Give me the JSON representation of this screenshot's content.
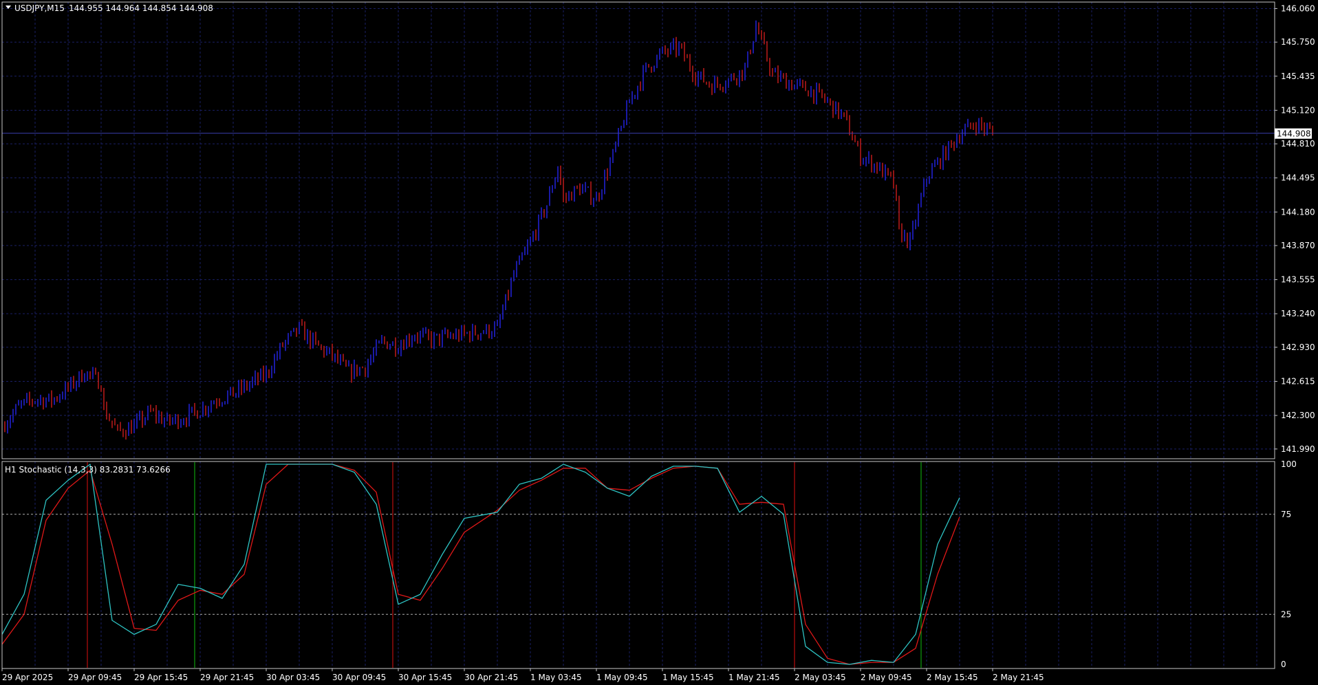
{
  "header": {
    "symbol_label": "USDJPY,M15",
    "ohlc_text": "144.955 144.964 144.854 144.908"
  },
  "price_axis": {
    "tick_labels": [
      "146.060",
      "145.750",
      "145.435",
      "145.120",
      "144.810",
      "144.495",
      "144.180",
      "143.870",
      "143.555",
      "143.240",
      "142.930",
      "142.615",
      "142.300",
      "141.990"
    ],
    "current_price_label": "144.908"
  },
  "indicator": {
    "label": "H1 Stochastic (14,3,3) 83.2831 73.6266",
    "levels": [
      "100",
      "75",
      "25",
      "0"
    ],
    "main_value": "83.2831",
    "signal_value": "73.6266"
  },
  "time_axis": {
    "tick_labels": [
      "29 Apr 2025",
      "29 Apr 09:45",
      "29 Apr 15:45",
      "29 Apr 21:45",
      "30 Apr 03:45",
      "30 Apr 09:45",
      "30 Apr 15:45",
      "30 Apr 21:45",
      "1 May 03:45",
      "1 May 09:45",
      "1 May 15:45",
      "1 May 21:45",
      "2 May 03:45",
      "2 May 09:45",
      "2 May 15:45",
      "2 May 21:45"
    ]
  },
  "colors": {
    "background": "#000000",
    "grid": "#1a1f66",
    "bull_bar": "#2828ff",
    "bear_bar": "#dc2020",
    "stoch_main": "#2ec4c4",
    "stoch_signal": "#e01818",
    "cross_up_line": "#10c010",
    "cross_down_line": "#e01010",
    "axis_text": "#ffffff"
  },
  "chart_data": [
    {
      "type": "candlestick",
      "symbol": "USDJPY",
      "timeframe": "M15",
      "ylim": [
        141.9,
        146.12
      ],
      "x_range": [
        "29 Apr 2025 03:45",
        "3 May 2025 03:45"
      ],
      "grid": true,
      "x_labels": [
        "29 Apr 2025",
        "29 Apr 09:45",
        "29 Apr 15:45",
        "29 Apr 21:45",
        "30 Apr 03:45",
        "30 Apr 09:45",
        "30 Apr 15:45",
        "30 Apr 21:45",
        "1 May 03:45",
        "1 May 09:45",
        "1 May 15:45",
        "1 May 21:45",
        "2 May 03:45",
        "2 May 09:45",
        "2 May 15:45",
        "2 May 21:45"
      ],
      "close_path": [
        [
          "29 Apr 03:45",
          142.2
        ],
        [
          "29 Apr 05:15",
          142.38
        ],
        [
          "29 Apr 06:45",
          142.45
        ],
        [
          "29 Apr 08:15",
          142.44
        ],
        [
          "29 Apr 09:45",
          142.55
        ],
        [
          "29 Apr 11:15",
          142.7
        ],
        [
          "29 Apr 12:45",
          142.6
        ],
        [
          "29 Apr 13:00",
          142.35
        ],
        [
          "29 Apr 14:15",
          142.15
        ],
        [
          "29 Apr 15:45",
          142.2
        ],
        [
          "29 Apr 17:15",
          142.33
        ],
        [
          "29 Apr 18:45",
          142.24
        ],
        [
          "29 Apr 20:15",
          142.28
        ],
        [
          "29 Apr 21:45",
          142.35
        ],
        [
          "29 Apr 23:15",
          142.45
        ],
        [
          "30 Apr 00:45",
          142.5
        ],
        [
          "30 Apr 03:45",
          142.68
        ],
        [
          "30 Apr 05:15",
          142.95
        ],
        [
          "30 Apr 06:45",
          143.1
        ],
        [
          "30 Apr 08:15",
          142.95
        ],
        [
          "30 Apr 09:45",
          142.85
        ],
        [
          "30 Apr 11:15",
          142.7
        ],
        [
          "30 Apr 12:45",
          142.75
        ],
        [
          "30 Apr 14:15",
          142.98
        ],
        [
          "30 Apr 15:45",
          142.95
        ],
        [
          "30 Apr 17:15",
          143.05
        ],
        [
          "30 Apr 18:45",
          143.0
        ],
        [
          "30 Apr 21:45",
          143.05
        ],
        [
          "1 May 00:45",
          143.1
        ],
        [
          "1 May 02:15",
          143.6
        ],
        [
          "1 May 03:45",
          143.9
        ],
        [
          "1 May 05:15",
          144.25
        ],
        [
          "1 May 06:15",
          144.6
        ],
        [
          "1 May 06:45",
          144.3
        ],
        [
          "1 May 08:15",
          144.4
        ],
        [
          "1 May 09:45",
          144.3
        ],
        [
          "1 May 11:15",
          144.7
        ],
        [
          "1 May 12:45",
          145.2
        ],
        [
          "1 May 14:15",
          145.5
        ],
        [
          "1 May 15:45",
          145.65
        ],
        [
          "1 May 17:15",
          145.7
        ],
        [
          "1 May 18:45",
          145.45
        ],
        [
          "1 May 20:15",
          145.35
        ],
        [
          "1 May 21:45",
          145.4
        ],
        [
          "1 May 23:15",
          145.5
        ],
        [
          "2 May 00:15",
          145.9
        ],
        [
          "2 May 01:45",
          145.45
        ],
        [
          "2 May 03:45",
          145.35
        ],
        [
          "2 May 05:15",
          145.3
        ],
        [
          "2 May 06:45",
          145.2
        ],
        [
          "2 May 08:15",
          145.05
        ],
        [
          "2 May 09:45",
          144.7
        ],
        [
          "2 May 11:15",
          144.6
        ],
        [
          "2 May 12:45",
          144.45
        ],
        [
          "2 May 13:15",
          144.0
        ],
        [
          "2 May 14:15",
          143.9
        ],
        [
          "2 May 15:45",
          144.5
        ],
        [
          "2 May 17:15",
          144.7
        ],
        [
          "2 May 18:45",
          144.9
        ],
        [
          "2 May 20:15",
          145.0
        ],
        [
          "2 May 21:45",
          144.908
        ]
      ],
      "last_bar": {
        "open": 144.955,
        "high": 144.964,
        "low": 144.854,
        "close": 144.908
      }
    },
    {
      "type": "line",
      "title": "H1 Stochastic (14,3,3)",
      "ylim": [
        0,
        100
      ],
      "levels": [
        25,
        75
      ],
      "series": [
        {
          "name": "main",
          "values": [
            [
              "29 Apr 03:45",
              15
            ],
            [
              "29 Apr 05:45",
              35
            ],
            [
              "29 Apr 07:45",
              82
            ],
            [
              "29 Apr 09:45",
              92
            ],
            [
              "29 Apr 11:45",
              100
            ],
            [
              "29 Apr 13:45",
              22
            ],
            [
              "29 Apr 15:45",
              15
            ],
            [
              "29 Apr 17:45",
              20
            ],
            [
              "29 Apr 19:45",
              40
            ],
            [
              "29 Apr 21:45",
              38
            ],
            [
              "29 Apr 23:45",
              33
            ],
            [
              "30 Apr 01:45",
              50
            ],
            [
              "30 Apr 03:45",
              100
            ],
            [
              "30 Apr 05:45",
              100
            ],
            [
              "30 Apr 07:45",
              100
            ],
            [
              "30 Apr 09:45",
              100
            ],
            [
              "30 Apr 11:45",
              96
            ],
            [
              "30 Apr 13:45",
              80
            ],
            [
              "30 Apr 15:45",
              30
            ],
            [
              "30 Apr 17:45",
              35
            ],
            [
              "30 Apr 19:45",
              55
            ],
            [
              "30 Apr 21:45",
              73
            ],
            [
              "1 May 00:45",
              76
            ],
            [
              "1 May 02:45",
              90
            ],
            [
              "1 May 04:45",
              93
            ],
            [
              "1 May 06:45",
              100
            ],
            [
              "1 May 08:45",
              96
            ],
            [
              "1 May 10:45",
              88
            ],
            [
              "1 May 12:45",
              84
            ],
            [
              "1 May 14:45",
              94
            ],
            [
              "1 May 16:45",
              99
            ],
            [
              "1 May 18:45",
              99
            ],
            [
              "1 May 20:45",
              98
            ],
            [
              "1 May 22:45",
              76
            ],
            [
              "2 May 00:45",
              84
            ],
            [
              "2 May 02:45",
              75
            ],
            [
              "2 May 04:45",
              9
            ],
            [
              "2 May 06:45",
              1
            ],
            [
              "2 May 08:45",
              0
            ],
            [
              "2 May 10:45",
              2
            ],
            [
              "2 May 12:45",
              1
            ],
            [
              "2 May 14:45",
              15
            ],
            [
              "2 May 16:45",
              60
            ],
            [
              "2 May 18:45",
              83.2831
            ]
          ]
        },
        {
          "name": "signal",
          "values": [
            [
              "29 Apr 03:45",
              10
            ],
            [
              "29 Apr 05:45",
              25
            ],
            [
              "29 Apr 07:45",
              72
            ],
            [
              "29 Apr 09:45",
              88
            ],
            [
              "29 Apr 11:45",
              97
            ],
            [
              "29 Apr 13:45",
              60
            ],
            [
              "29 Apr 15:45",
              18
            ],
            [
              "29 Apr 17:45",
              17
            ],
            [
              "29 Apr 19:45",
              32
            ],
            [
              "29 Apr 21:45",
              37
            ],
            [
              "29 Apr 23:45",
              35
            ],
            [
              "30 Apr 01:45",
              45
            ],
            [
              "30 Apr 03:45",
              90
            ],
            [
              "30 Apr 05:45",
              100
            ],
            [
              "30 Apr 07:45",
              100
            ],
            [
              "30 Apr 09:45",
              100
            ],
            [
              "30 Apr 11:45",
              97
            ],
            [
              "30 Apr 13:45",
              86
            ],
            [
              "30 Apr 15:45",
              35
            ],
            [
              "30 Apr 17:45",
              32
            ],
            [
              "30 Apr 19:45",
              48
            ],
            [
              "30 Apr 21:45",
              66
            ],
            [
              "1 May 00:45",
              77
            ],
            [
              "1 May 02:45",
              87
            ],
            [
              "1 May 04:45",
              92
            ],
            [
              "1 May 06:45",
              98
            ],
            [
              "1 May 08:45",
              98
            ],
            [
              "1 May 10:45",
              88
            ],
            [
              "1 May 12:45",
              87
            ],
            [
              "1 May 14:45",
              93
            ],
            [
              "1 May 16:45",
              98
            ],
            [
              "1 May 18:45",
              99
            ],
            [
              "1 May 20:45",
              98
            ],
            [
              "1 May 22:45",
              80
            ],
            [
              "2 May 00:45",
              81
            ],
            [
              "2 May 02:45",
              80
            ],
            [
              "2 May 04:45",
              20
            ],
            [
              "2 May 06:45",
              3
            ],
            [
              "2 May 08:45",
              0
            ],
            [
              "2 May 10:45",
              1
            ],
            [
              "2 May 12:45",
              1
            ],
            [
              "2 May 14:45",
              8
            ],
            [
              "2 May 16:45",
              45
            ],
            [
              "2 May 18:45",
              73.6266
            ]
          ]
        }
      ],
      "cross_markers": [
        {
          "time": "29 Apr 03:45",
          "direction": "up"
        },
        {
          "time": "29 Apr 11:30",
          "direction": "down"
        },
        {
          "time": "29 Apr 21:15",
          "direction": "up"
        },
        {
          "time": "30 Apr 15:15",
          "direction": "down"
        },
        {
          "time": "2 May 03:45",
          "direction": "down"
        },
        {
          "time": "2 May 15:15",
          "direction": "up"
        }
      ]
    }
  ]
}
